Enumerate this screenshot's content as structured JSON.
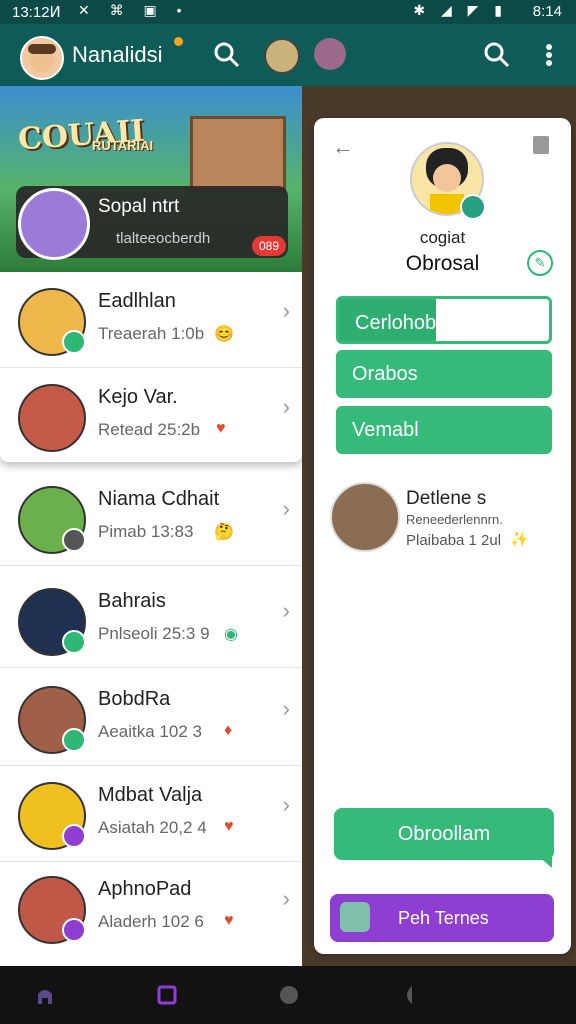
{
  "status_bar": {
    "time": "13:12Ͷ",
    "right_time": "8:14",
    "left_icons": "✕ ⌘ ▣ •",
    "right_icons": "✱ ◢ ◤ ▮"
  },
  "app_bar": {
    "title": "Nanalidsi",
    "accent": "#0e5b57",
    "badge_color": "#f5a623"
  },
  "banner": {
    "game_title": "COUAII",
    "game_subtitle": "RUTARIAI",
    "featured_name": "Sopal ntrt",
    "featured_sub": "tlalteeocberdh",
    "featured_badge": "089"
  },
  "popular": [
    {
      "name": "Eadlhlan",
      "sub": "Treaerah 1:0b",
      "emoji": "😊",
      "emoji_color": "#f0a020"
    },
    {
      "name": "Kejo Var.",
      "sub": "Retead 25:2b",
      "emoji": "♥",
      "emoji_color": "#e04a30"
    }
  ],
  "contacts": [
    {
      "name": "Niama Cdhait",
      "sub": "Pimab 13:83",
      "emoji": "🤔",
      "emoji_color": "#f0a020"
    },
    {
      "name": "Bahrais",
      "sub": "Pnlseoli 25:3 9",
      "emoji": "◉",
      "emoji_color": "#2fb776"
    },
    {
      "name": "BobdRa",
      "sub": "Aeaitka 102 3",
      "emoji": "♦",
      "emoji_color": "#e04a30"
    },
    {
      "name": "Mdbat Valja",
      "sub": "Asiatah 20,2 4",
      "emoji": "♥",
      "emoji_color": "#e04a30"
    },
    {
      "name": "AphnoPad",
      "sub": "Aladerh 102 6",
      "emoji": "♥",
      "emoji_color": "#e04a30"
    }
  ],
  "profile": {
    "subtitle": "cogiat",
    "name": "Obrosal",
    "buttons": [
      "Cerlohobl",
      "Orabos",
      "Vemabl"
    ],
    "contact_name": "Detlene s",
    "contact_role": "Reneederlennrn.",
    "contact_time": "Plaibaba 1 2ul",
    "contact_emoji": "✨",
    "cta": "Obroollam",
    "purple_button": "Peh Ternes",
    "brand_green": "#35ba7a",
    "brand_purple": "#8e3fd2"
  }
}
